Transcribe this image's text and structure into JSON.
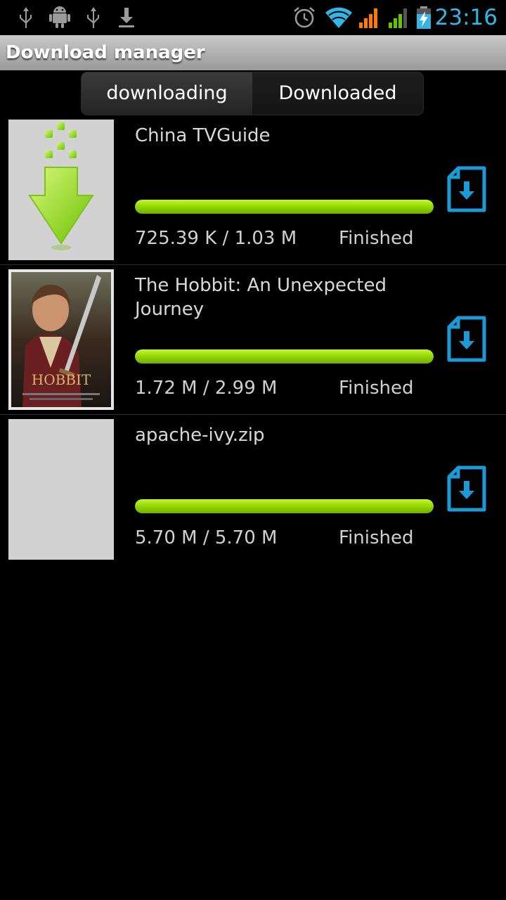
{
  "status_bar": {
    "time": "23:16",
    "left_icons": [
      "usb-icon",
      "android-debug-icon",
      "usb-icon",
      "download-icon"
    ],
    "right_icons": [
      "alarm-icon",
      "wifi-icon",
      "signal-icon",
      "signal-icon",
      "battery-charging-icon"
    ],
    "clock_color": "#33b5e5"
  },
  "header": {
    "title": "Download manager"
  },
  "tabs": [
    {
      "label": "downloading",
      "active": true
    },
    {
      "label": "Downloaded",
      "active": false
    }
  ],
  "downloads": [
    {
      "name": "China TVGuide",
      "size": "725.39 K / 1.03 M",
      "status": "Finished",
      "progress": 1.0,
      "thumbnail": "download-arrow-icon"
    },
    {
      "name": "The Hobbit: An Unexpected Journey",
      "size": "1.72 M / 2.99 M",
      "status": "Finished",
      "progress": 1.0,
      "thumbnail": "movie-poster"
    },
    {
      "name": "apache-ivy.zip",
      "size": "5.70 M / 5.70 M",
      "status": "Finished",
      "progress": 1.0,
      "thumbnail": "blank"
    }
  ],
  "colors": {
    "progress": "#8fd400",
    "accent": "#33b5e5"
  }
}
